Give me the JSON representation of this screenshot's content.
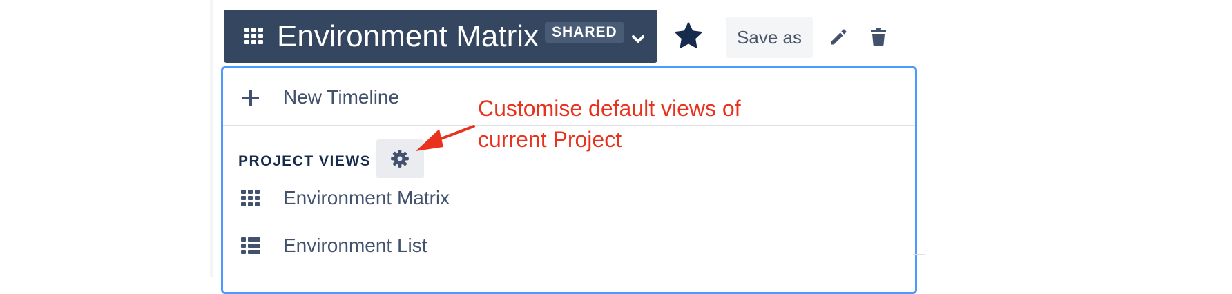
{
  "toolbar": {
    "view_title": "Environment Matrix",
    "shared_badge": "SHARED",
    "save_as_label": "Save as",
    "icons": {
      "view": "grid-icon",
      "dropdown": "chevron-down-icon",
      "favourite": "star-icon",
      "edit": "pencil-icon",
      "delete": "trash-icon"
    }
  },
  "dropdown": {
    "new_timeline_label": "New Timeline",
    "section_header": "PROJECT VIEWS",
    "items": [
      {
        "label": "Environment Matrix",
        "icon": "grid-icon"
      },
      {
        "label": "Environment List",
        "icon": "list-icon"
      }
    ]
  },
  "annotation": {
    "lines": [
      "Customise default views of",
      "current Project"
    ],
    "color": "#e8321e"
  },
  "colors": {
    "header_bg": "#354660",
    "accent_border": "#4c9aff",
    "text": "#42526e",
    "heading": "#172b4d"
  }
}
